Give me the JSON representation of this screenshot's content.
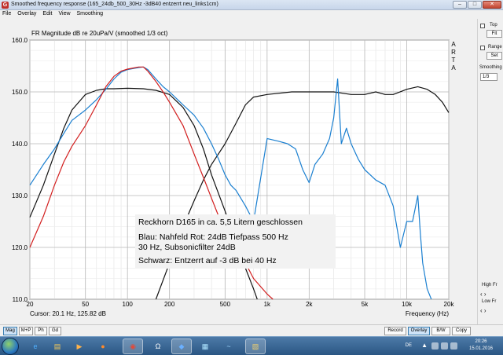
{
  "window": {
    "title": "Smoothed frequency response (165_24db_500_30Hz -3dB40 entzerrt neu_links1cm)",
    "minimize_label": "–",
    "maximize_label": "□",
    "close_label": "✕",
    "icon_letter": "G"
  },
  "menu": [
    "File",
    "Overlay",
    "Edit",
    "View",
    "Smoothing"
  ],
  "plot": {
    "title": "FR Magnitude dB re 20uPa/V (smoothed 1/3 oct)",
    "arta_label": [
      "A",
      "R",
      "T",
      "A"
    ],
    "cursor_text": "Cursor: 20.1 Hz, 125.82 dB",
    "frequency_label": "Frequency (Hz)",
    "annotation": {
      "line1": "Reckhorn D165 in ca. 5,5 Litern geschlossen",
      "line2": "Blau: Nahfeld  Rot: 24dB Tiefpass 500 Hz",
      "line3": "30 Hz,  Subsonicfilter 24dB",
      "line4": "Schwarz: Entzerrt auf -3 dB bei 40 Hz"
    }
  },
  "chart_data": {
    "type": "line",
    "title": "FR Magnitude dB re 20uPa/V (smoothed 1/3 oct)",
    "xlabel": "Frequency (Hz)",
    "ylabel": "",
    "x_scale": "log",
    "xlim": [
      20,
      20000
    ],
    "ylim": [
      110,
      160
    ],
    "grid": true,
    "x_ticks": [
      "20",
      "50",
      "100",
      "200",
      "500",
      "1k",
      "2k",
      "5k",
      "10k",
      "20k"
    ],
    "x_tick_values": [
      20,
      50,
      100,
      200,
      500,
      1000,
      2000,
      5000,
      10000,
      20000
    ],
    "y_ticks": [
      "110.0",
      "120.0",
      "130.0",
      "140.0",
      "150.0",
      "160.0"
    ],
    "y_tick_values": [
      110,
      120,
      130,
      140,
      150,
      160
    ],
    "series": [
      {
        "name": "Blau",
        "color": "#1a7fd0",
        "points": [
          [
            20,
            132
          ],
          [
            25,
            136
          ],
          [
            30,
            139
          ],
          [
            35,
            142
          ],
          [
            40,
            144.5
          ],
          [
            50,
            146.5
          ],
          [
            60,
            148.5
          ],
          [
            70,
            150.5
          ],
          [
            80,
            152.5
          ],
          [
            90,
            153.8
          ],
          [
            100,
            154.3
          ],
          [
            110,
            154.5
          ],
          [
            120,
            154.7
          ],
          [
            130,
            154.8
          ],
          [
            140,
            154.3
          ],
          [
            160,
            152.5
          ],
          [
            180,
            151
          ],
          [
            200,
            150
          ],
          [
            250,
            147.5
          ],
          [
            300,
            145.5
          ],
          [
            350,
            143
          ],
          [
            400,
            140
          ],
          [
            450,
            137
          ],
          [
            500,
            134
          ],
          [
            550,
            132
          ],
          [
            600,
            131
          ],
          [
            700,
            128
          ],
          [
            800,
            125
          ],
          [
            1000,
            141
          ],
          [
            1200,
            140.5
          ],
          [
            1400,
            140
          ],
          [
            1600,
            139
          ],
          [
            1800,
            135
          ],
          [
            2000,
            132.5
          ],
          [
            2200,
            136
          ],
          [
            2500,
            138
          ],
          [
            2800,
            141
          ],
          [
            3000,
            145
          ],
          [
            3200,
            152.5
          ],
          [
            3400,
            140
          ],
          [
            3700,
            143
          ],
          [
            4000,
            140
          ],
          [
            4500,
            137
          ],
          [
            5000,
            135
          ],
          [
            6000,
            133
          ],
          [
            7000,
            132
          ],
          [
            8000,
            128
          ],
          [
            9000,
            120
          ],
          [
            10000,
            125
          ],
          [
            11000,
            125
          ],
          [
            12000,
            130
          ],
          [
            12500,
            123
          ],
          [
            13000,
            117
          ],
          [
            14000,
            112
          ],
          [
            15000,
            110
          ]
        ]
      },
      {
        "name": "Rot",
        "color": "#d21e1e",
        "points": [
          [
            20,
            120
          ],
          [
            25,
            126
          ],
          [
            30,
            132
          ],
          [
            35,
            136.5
          ],
          [
            40,
            139.5
          ],
          [
            50,
            143.5
          ],
          [
            60,
            147.5
          ],
          [
            70,
            151
          ],
          [
            80,
            153
          ],
          [
            90,
            154
          ],
          [
            100,
            154.4
          ],
          [
            110,
            154.6
          ],
          [
            120,
            154.8
          ],
          [
            130,
            154.8
          ],
          [
            140,
            154
          ],
          [
            160,
            152
          ],
          [
            180,
            150
          ],
          [
            200,
            148
          ],
          [
            250,
            143.5
          ],
          [
            300,
            138
          ],
          [
            350,
            133.5
          ],
          [
            400,
            129.5
          ],
          [
            450,
            126
          ],
          [
            500,
            123
          ],
          [
            600,
            120
          ],
          [
            700,
            117
          ],
          [
            800,
            114
          ],
          [
            1000,
            111
          ],
          [
            1100,
            110
          ]
        ]
      },
      {
        "name": "Schwarz",
        "color": "#111111",
        "points": [
          [
            20,
            125.8
          ],
          [
            25,
            132
          ],
          [
            30,
            138
          ],
          [
            35,
            143
          ],
          [
            40,
            146.5
          ],
          [
            50,
            149.5
          ],
          [
            60,
            150.3
          ],
          [
            70,
            150.6
          ],
          [
            80,
            150.6
          ],
          [
            100,
            150.7
          ],
          [
            130,
            150.6
          ],
          [
            160,
            150.3
          ],
          [
            200,
            149.5
          ],
          [
            250,
            147
          ],
          [
            300,
            143.5
          ],
          [
            350,
            139
          ],
          [
            400,
            134
          ],
          [
            500,
            127
          ],
          [
            600,
            121
          ],
          [
            700,
            116
          ],
          [
            800,
            112
          ],
          [
            850,
            110
          ]
        ]
      },
      {
        "name": "Schwarz-entzerrt",
        "color": "#111111",
        "points": [
          [
            160,
            110
          ],
          [
            200,
            117
          ],
          [
            250,
            124
          ],
          [
            300,
            129
          ],
          [
            350,
            133
          ],
          [
            400,
            136
          ],
          [
            500,
            140
          ],
          [
            600,
            144
          ],
          [
            700,
            147.5
          ],
          [
            800,
            149
          ],
          [
            1000,
            149.5
          ],
          [
            1500,
            150
          ],
          [
            2000,
            150
          ],
          [
            3000,
            150
          ],
          [
            4000,
            149.5
          ],
          [
            5000,
            149.5
          ],
          [
            6000,
            150
          ],
          [
            7000,
            149.5
          ],
          [
            8000,
            149.5
          ],
          [
            10000,
            150.5
          ],
          [
            12000,
            151
          ],
          [
            14000,
            150.5
          ],
          [
            16000,
            149.5
          ],
          [
            18000,
            148
          ],
          [
            20000,
            146
          ]
        ]
      }
    ]
  },
  "sidebar": {
    "top_label": "Top",
    "fit_label": "Fit",
    "range_label": "Range",
    "set_label": "Set",
    "smoothing_label": "Smoothing",
    "smoothing_value": "1/3",
    "high_fr_label": "High Fr",
    "low_fr_label": "Low Fr"
  },
  "bottom_buttons_left": [
    "Mag",
    "M+P",
    "Ph",
    "Gd"
  ],
  "bottom_buttons_right": [
    "Record",
    "Overlay",
    "B/W",
    "Copy"
  ],
  "taskbar": {
    "icons": [
      "ie",
      "explorer",
      "media",
      "firefox",
      "chrome",
      "omega",
      "dsp",
      "tile",
      "paint",
      "doc"
    ],
    "icon_glyphs": [
      "e",
      "▤",
      "▶",
      "●",
      "◉",
      "Ω",
      "◆",
      "▦",
      "~",
      "▧"
    ],
    "lang": "DE",
    "time": "20:26",
    "date": "15.01.2016"
  }
}
